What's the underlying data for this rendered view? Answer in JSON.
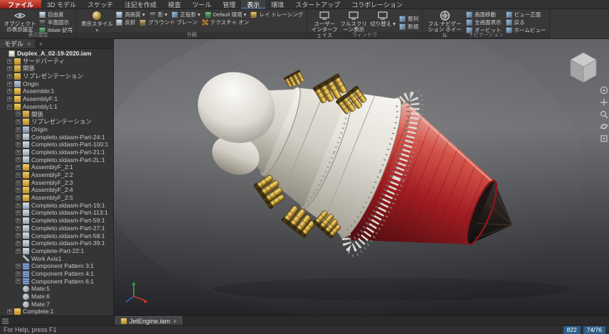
{
  "colors": {
    "file_button_red": "#c13a30",
    "active_tab_underline": "#5b9bd5",
    "viewport_gray_top": "#626467",
    "viewport_gray_bottom": "#222427",
    "engine_body_white": "#e8e4dc",
    "engine_gold": "#c9992c",
    "engine_exhaust_red": "#a31d22",
    "badge_blue": "#2e5f8a"
  },
  "icons": {
    "chevron_down": "▾",
    "close": "×",
    "add": "+"
  },
  "menubar": {
    "file_button": "ファイル",
    "tabs": [
      {
        "label": "3D モデル"
      },
      {
        "label": "スケッチ"
      },
      {
        "label": "注記を作成"
      },
      {
        "label": "検査"
      },
      {
        "label": "ツール"
      },
      {
        "label": "管理"
      },
      {
        "label": "表示",
        "active": true
      },
      {
        "label": "環境"
      },
      {
        "label": "スタートアップ"
      },
      {
        "label": "コラボレーション"
      }
    ]
  },
  "ribbon": {
    "display_settings": {
      "group_label": "表示設定",
      "big_button": {
        "label": "オブジェクトの表示設定",
        "icon": "visibility-eye"
      },
      "items": [
        {
          "label": "自由度",
          "icon": "quality"
        },
        {
          "label": "半面図示",
          "icon": "shadow"
        },
        {
          "label": "iMate 記号",
          "icon": "environment"
        }
      ]
    },
    "appearance": {
      "group_label": "外観",
      "big_button": {
        "label": "表示スタイル",
        "icon": "visual-style"
      },
      "row1": [
        {
          "label": "高画質 ▾",
          "icon": "quality"
        },
        {
          "label": "影 ▾",
          "icon": "shadow"
        },
        {
          "label": "正投影 ▾",
          "icon": "ortho-camera"
        },
        {
          "label": "Default 環境 ▾",
          "icon": "environment"
        },
        {
          "label": "レイ トレーシング",
          "icon": "ray-tracing"
        }
      ],
      "row2": [
        {
          "label": "反射",
          "icon": "quality"
        },
        {
          "label": "グラウンド プレーン",
          "icon": "ground-plane"
        },
        {
          "label": "テクスチャ オン",
          "icon": "texture"
        }
      ]
    },
    "window": {
      "group_label": "ウィンドウ",
      "items_main": [
        {
          "label": "ユーザー インターフェイス",
          "icon": "user-interface"
        },
        {
          "label": "フルスクリーン表示",
          "icon": "full-screen"
        },
        {
          "label": "切り替え ▾",
          "icon": "switch-windows"
        }
      ],
      "items_side": [
        {
          "label": "整列",
          "icon": "arrange-windows"
        },
        {
          "label": "新規",
          "icon": "new-window"
        }
      ]
    },
    "navigation": {
      "group_label": "ナビゲーション",
      "big_button": {
        "label": "フル ナビゲーション ホイール",
        "icon": "navigation-wheel"
      },
      "col1": [
        {
          "label": "画面移動",
          "icon": "pan"
        },
        {
          "label": "全画面表示",
          "icon": "zoom-all"
        },
        {
          "label": "オービット",
          "icon": "orbit"
        }
      ],
      "col2": [
        {
          "label": "ビュー正面",
          "icon": "look-at"
        },
        {
          "label": "戻る",
          "icon": "previous-view"
        },
        {
          "label": "ホームビュー",
          "icon": "home-view"
        }
      ]
    }
  },
  "browser": {
    "tab_label": "モデル",
    "tab_close": "×",
    "add_tab": "+",
    "tree": [
      {
        "label": "Duplex_A_02-19-2020.iam",
        "icon": "assembly-doc",
        "indent": 2,
        "expand": "",
        "bold": true
      },
      {
        "label": "サードパーティ",
        "icon": "folder",
        "indent": 10,
        "expand": "+"
      },
      {
        "label": "関係",
        "icon": "folder",
        "indent": 10,
        "expand": "+"
      },
      {
        "label": "リプレゼンテーション",
        "icon": "folder",
        "indent": 10,
        "expand": "+"
      },
      {
        "label": "Origin",
        "icon": "origin",
        "indent": 10,
        "expand": "+"
      },
      {
        "label": "Assemble:1",
        "icon": "assembly",
        "indent": 10,
        "expand": "+"
      },
      {
        "label": "AssemblyF:1",
        "icon": "assembly",
        "indent": 10,
        "expand": "+"
      },
      {
        "label": "Assembly1:1",
        "icon": "assembly",
        "indent": 10,
        "expand": "−"
      },
      {
        "label": "関係",
        "icon": "folder",
        "indent": 22,
        "expand": "+"
      },
      {
        "label": "リプレゼンテーション",
        "icon": "folder",
        "indent": 22,
        "expand": "+"
      },
      {
        "label": "Origin",
        "icon": "origin",
        "indent": 22,
        "expand": "+"
      },
      {
        "label": "Completo.sldasm-Part-24:1",
        "icon": "part",
        "indent": 22,
        "expand": "+"
      },
      {
        "label": "Completo.sldasm-Part-100:1",
        "icon": "part",
        "indent": 22,
        "expand": "+"
      },
      {
        "label": "Completo.sldasm-Part-21:1",
        "icon": "part",
        "indent": 22,
        "expand": "+"
      },
      {
        "label": "Completo.sldasm-Part-2L:1",
        "icon": "part",
        "indent": 22,
        "expand": "+"
      },
      {
        "label": "AssemblyF_2:1",
        "icon": "assembly",
        "indent": 22,
        "expand": "+"
      },
      {
        "label": "AssemblyF_2:2",
        "icon": "assembly",
        "indent": 22,
        "expand": "+"
      },
      {
        "label": "AssemblyF_2:3",
        "icon": "assembly",
        "indent": 22,
        "expand": "+"
      },
      {
        "label": "AssemblyF_2:4",
        "icon": "assembly",
        "indent": 22,
        "expand": "+"
      },
      {
        "label": "AssemblyF_2:5",
        "icon": "assembly",
        "indent": 22,
        "expand": "+"
      },
      {
        "label": "Completo.sldasm-Part-19:1",
        "icon": "part",
        "indent": 22,
        "expand": "+"
      },
      {
        "label": "Completo.sldasm-Part-113:1",
        "icon": "part",
        "indent": 22,
        "expand": "+"
      },
      {
        "label": "Completo.sldasm-Part-59:1",
        "icon": "part",
        "indent": 22,
        "expand": "+"
      },
      {
        "label": "Completo.sldasm-Part-27:1",
        "icon": "part",
        "indent": 22,
        "expand": "+"
      },
      {
        "label": "Completo.sldasm-Part-58:1",
        "icon": "part",
        "indent": 22,
        "expand": "+"
      },
      {
        "label": "Completo.sldasm-Part-39:1",
        "icon": "part",
        "indent": 22,
        "expand": "+"
      },
      {
        "label": "Complete-Part-22:1",
        "icon": "part",
        "indent": 22,
        "expand": "+"
      },
      {
        "label": "Work Axis1",
        "icon": "work-axis",
        "indent": 22,
        "expand": ""
      },
      {
        "label": "Component Pattern 3:1",
        "icon": "pattern",
        "indent": 22,
        "expand": "+"
      },
      {
        "label": "Component Pattern 4:1",
        "icon": "pattern",
        "indent": 22,
        "expand": "+"
      },
      {
        "label": "Component Pattern 6:1",
        "icon": "pattern",
        "indent": 22,
        "expand": "+"
      },
      {
        "label": "Mate:5",
        "icon": "mate",
        "indent": 22,
        "expand": ""
      },
      {
        "label": "Mate:6",
        "icon": "mate",
        "indent": 22,
        "expand": ""
      },
      {
        "label": "Mate:7",
        "icon": "mate",
        "indent": 22,
        "expand": ""
      },
      {
        "label": "Complete:1",
        "icon": "assembly",
        "indent": 10,
        "expand": "+"
      }
    ]
  },
  "viewport_overlay": {
    "nav_icons": [
      "navigation-wheel-icon",
      "pan-icon",
      "zoom-icon",
      "orbit-icon",
      "look-at-icon"
    ]
  },
  "document_tabs": {
    "active_tab": "JetEngine.iam",
    "close_icon": "×"
  },
  "statusbar": {
    "help_text": "For Help, press F1",
    "occurrence_count": "822",
    "file_count": "74/76"
  }
}
